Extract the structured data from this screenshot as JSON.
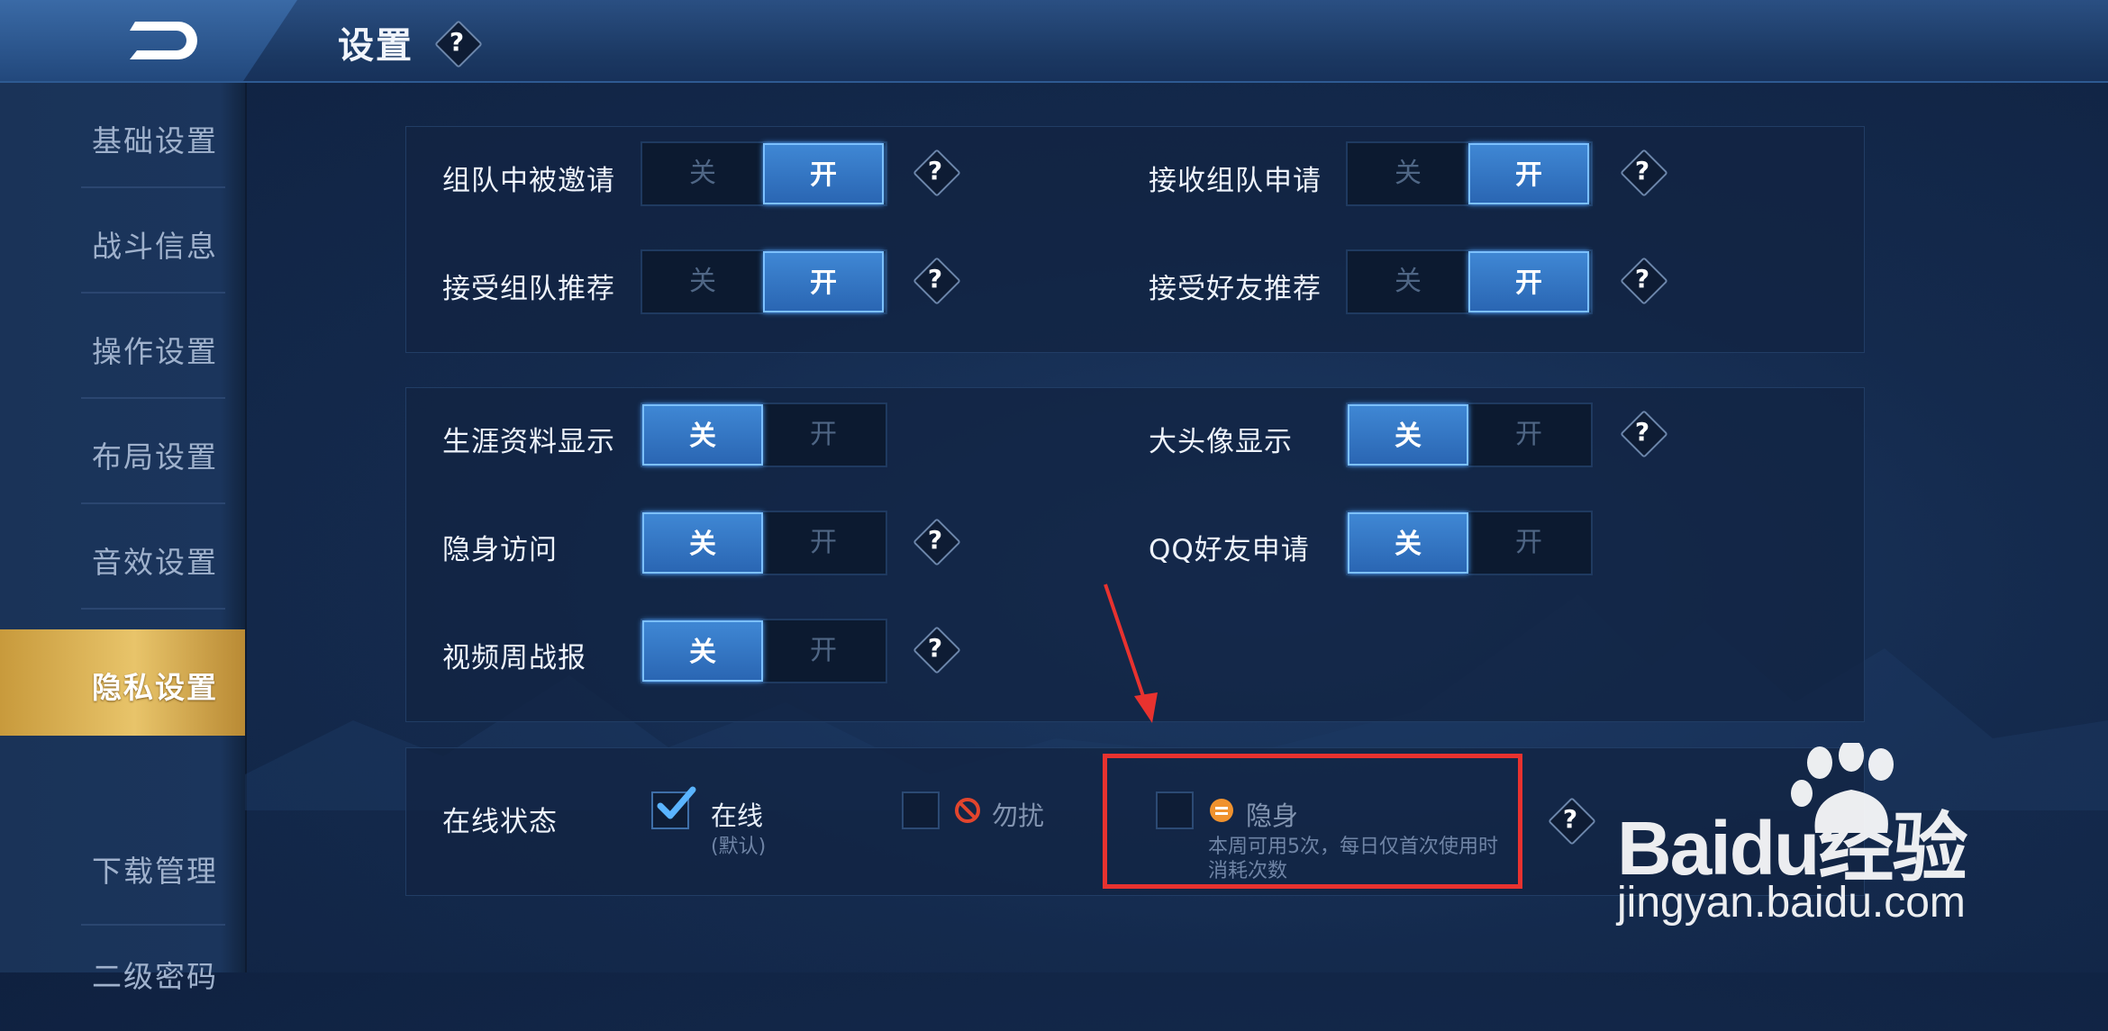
{
  "header": {
    "title": "设置",
    "help": "?"
  },
  "sidebar": {
    "items": [
      {
        "label": "基础设置",
        "active": false
      },
      {
        "label": "战斗信息",
        "active": false
      },
      {
        "label": "操作设置",
        "active": false
      },
      {
        "label": "布局设置",
        "active": false
      },
      {
        "label": "音效设置",
        "active": false
      },
      {
        "label": "隐私设置",
        "active": true
      },
      {
        "label": "下载管理",
        "active": false
      },
      {
        "label": "二级密码",
        "active": false
      }
    ]
  },
  "toggle_labels": {
    "off": "关",
    "on": "开"
  },
  "help_glyph": "?",
  "team_settings": [
    {
      "label": "组队中被邀请",
      "state": "开",
      "help": true
    },
    {
      "label": "接收组队申请",
      "state": "开",
      "help": true
    },
    {
      "label": "接受组队推荐",
      "state": "开",
      "help": true
    },
    {
      "label": "接受好友推荐",
      "state": "开",
      "help": true
    }
  ],
  "privacy_settings": [
    {
      "label": "生涯资料显示",
      "state": "关",
      "help": false
    },
    {
      "label": "大头像显示",
      "state": "关",
      "help": true
    },
    {
      "label": "隐身访问",
      "state": "关",
      "help": true
    },
    {
      "label": "QQ好友申请",
      "state": "关",
      "help": false
    },
    {
      "label": "视频周战报",
      "state": "关",
      "help": true
    }
  ],
  "online_status": {
    "label": "在线状态",
    "options": [
      {
        "label": "在线",
        "sub": "(默认)",
        "checked": true,
        "icon": "checkmark-icon"
      },
      {
        "label": "勿扰",
        "checked": false,
        "icon": "no-entry-icon"
      },
      {
        "label": "隐身",
        "sub_line1": "本周可用5次，每日仅首次使用时",
        "sub_line2": "消耗次数",
        "checked": false,
        "icon": "invisible-icon"
      }
    ]
  },
  "watermark": {
    "brand": "Baidu经验",
    "url": "jingyan.baidu.com"
  },
  "colors": {
    "accent": "#3f87d4",
    "active_tab": "#e0b65a",
    "highlight": "#e8322f"
  }
}
